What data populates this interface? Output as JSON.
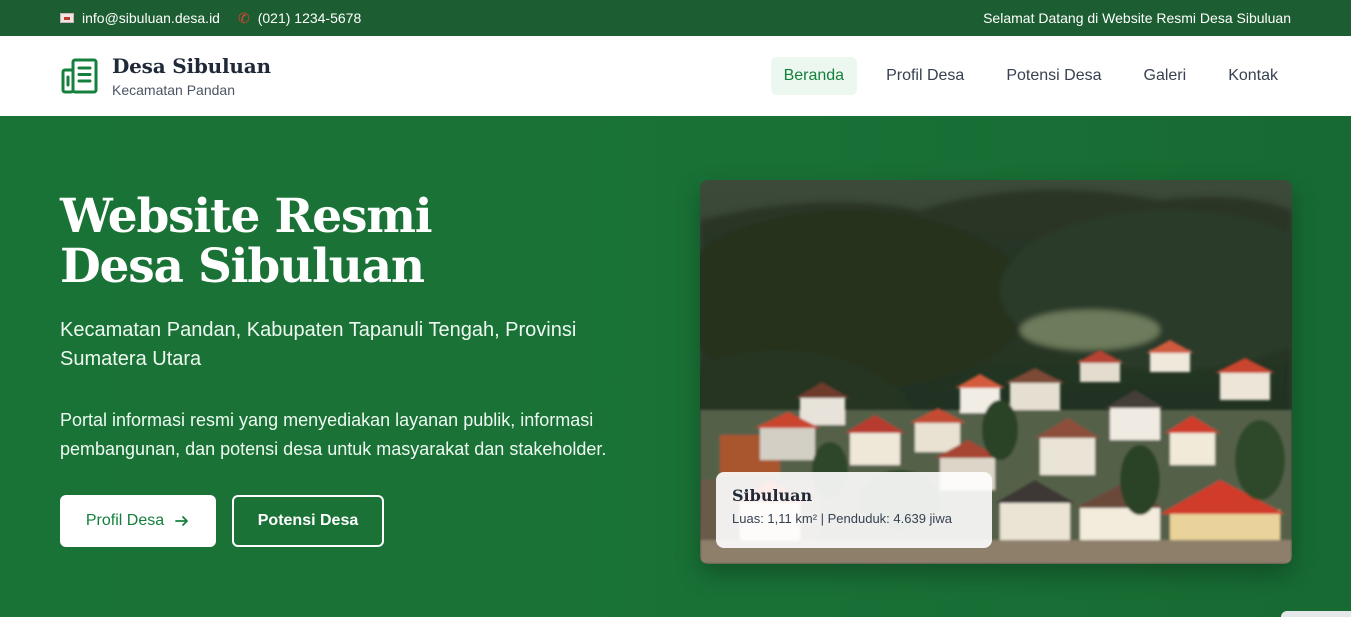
{
  "topbar": {
    "email": "info@sibuluan.desa.id",
    "phone": "(021) 1234-5678",
    "welcome": "Selamat Datang di Website Resmi Desa Sibuluan",
    "email_icon": "mail-icon",
    "phone_icon": "phone-icon"
  },
  "brand": {
    "name": "Desa Sibuluan",
    "subtitle": "Kecamatan Pandan",
    "icon": "building-icon"
  },
  "nav": {
    "items": [
      {
        "label": "Beranda",
        "active": true
      },
      {
        "label": "Profil Desa",
        "active": false
      },
      {
        "label": "Potensi Desa",
        "active": false
      },
      {
        "label": "Galeri",
        "active": false
      },
      {
        "label": "Kontak",
        "active": false
      }
    ]
  },
  "hero": {
    "title_line1": "Website Resmi",
    "title_line2": "Desa Sibuluan",
    "subtitle": "Kecamatan Pandan, Kabupaten Tapanuli Tengah, Provinsi Sumatera Utara",
    "description": "Portal informasi resmi yang menyediakan layanan publik, informasi pembangunan, dan potensi desa untuk masyarakat dan stakeholder.",
    "primary_button": "Profil Desa",
    "primary_button_icon": "arrow-right-icon",
    "secondary_button": "Potensi Desa"
  },
  "photo_card": {
    "title": "Sibuluan",
    "meta": "Luas: 1,11 km² | Penduduk: 4.639 jiwa"
  },
  "colors": {
    "primary_green": "#15803d",
    "hero_bg": "#1a7336",
    "topbar_bg": "#1c5e31"
  }
}
